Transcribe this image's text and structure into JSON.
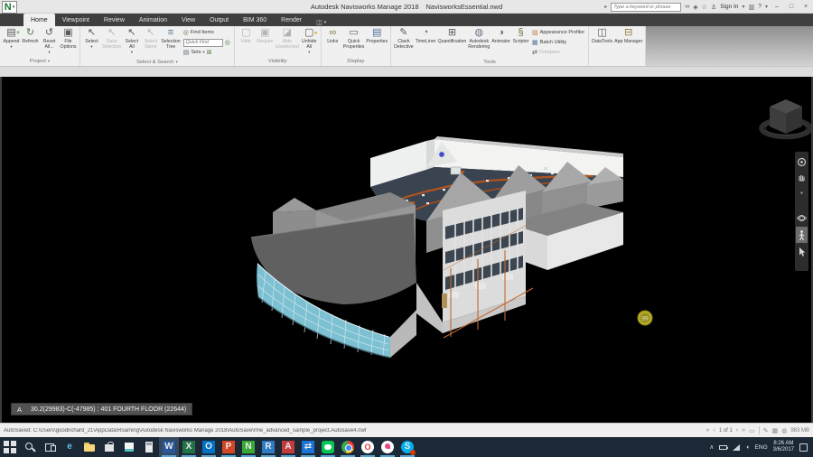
{
  "glyphs": {
    "dropdown": "▾",
    "caret_right": "▸",
    "minimize": "–",
    "maximize": "□",
    "close": "×",
    "question": "?",
    "cart": "▥",
    "star": "☆",
    "person": "♙",
    "binoculars": "∞",
    "exchange": "◈",
    "nav_first": "«",
    "nav_prev": "‹",
    "nav_next": "›",
    "nav_last": "»",
    "sheet": "▭",
    "pencil": "✎",
    "disk": "▦",
    "globe": "◍",
    "chevron_up": "∧",
    "volume": "◖",
    "ribbon_toggle": "◫"
  },
  "titlebar": {
    "logo_letter": "N",
    "title_app": "Autodesk Navisworks Manage 2018",
    "title_doc": "NavisworksEssential.nwd",
    "search_placeholder": "Type a keyword or phrase",
    "signin_label": "Sign In"
  },
  "tabs": [
    {
      "name": "tab-home",
      "label": "Home",
      "active": true
    },
    {
      "name": "tab-viewpoint",
      "label": "Viewpoint"
    },
    {
      "name": "tab-review",
      "label": "Review"
    },
    {
      "name": "tab-animation",
      "label": "Animation"
    },
    {
      "name": "tab-view",
      "label": "View"
    },
    {
      "name": "tab-output",
      "label": "Output"
    },
    {
      "name": "tab-bim360",
      "label": "BIM 360"
    },
    {
      "name": "tab-render",
      "label": "Render"
    }
  ],
  "ribbon": {
    "groups": [
      {
        "label": "Project",
        "buttons": [
          {
            "name": "append-button",
            "icon": "▤",
            "badge": "+",
            "bcolor": "#2e8b2e",
            "l1": "Append",
            "l2": "",
            "arrow": true
          },
          {
            "name": "refresh-button",
            "icon": "↻",
            "icolor": "#5a7a5a",
            "l1": "Refresh",
            "l2": ""
          },
          {
            "name": "reset-all-button",
            "icon": "↺",
            "l1": "Reset",
            "l2": "All...",
            "arrow": true
          },
          {
            "name": "file-options-button",
            "icon": "▣",
            "l1": "File",
            "l2": "Options"
          }
        ]
      },
      {
        "label": "Select & Search",
        "buttons": [
          {
            "name": "select-button",
            "icon": "↖",
            "l1": "Select",
            "l2": "",
            "arrow": true
          },
          {
            "name": "save-selection-button",
            "icon": "↖",
            "l1": "Save",
            "l2": "Selection",
            "disabled": true
          },
          {
            "name": "select-all-button",
            "icon": "↖",
            "l1": "Select",
            "l2": "All",
            "arrow": true
          },
          {
            "name": "select-same-button",
            "icon": "↖",
            "l1": "Select",
            "l2": "Same",
            "disabled": true
          },
          {
            "name": "selection-tree-button",
            "icon": "≡",
            "icolor": "#4f7396",
            "l1": "Selection",
            "l2": "Tree"
          }
        ]
      },
      {
        "label": "Visibility",
        "buttons": [
          {
            "name": "hide-button",
            "icon": "▢",
            "l1": "Hide",
            "l2": "",
            "disabled": true
          },
          {
            "name": "require-button",
            "icon": "▣",
            "l1": "Require",
            "l2": "",
            "disabled": true
          },
          {
            "name": "hide-unselected-button",
            "icon": "◪",
            "l1": "Hide",
            "l2": "Unselected",
            "disabled": true
          },
          {
            "name": "unhide-all-button",
            "icon": "▢",
            "badge": "●",
            "bcolor": "#d8b818",
            "l1": "Unhide",
            "l2": "All",
            "arrow": true
          }
        ]
      },
      {
        "label": "Display",
        "buttons": [
          {
            "name": "links-button",
            "icon": "∞",
            "icolor": "#8a7250",
            "l1": "Links",
            "l2": ""
          },
          {
            "name": "quick-properties-button",
            "icon": "▭",
            "icolor": "#5a6a7a",
            "l1": "Quick",
            "l2": "Properties"
          },
          {
            "name": "properties-button",
            "icon": "▤",
            "icolor": "#4f7396",
            "l1": "Properties",
            "l2": ""
          }
        ]
      },
      {
        "label": "Tools",
        "buttons": [
          {
            "name": "clash-detective-button",
            "icon": "✎",
            "l1": "Clash",
            "l2": "Detective"
          },
          {
            "name": "timeliner-button",
            "icon": "◔",
            "icolor": "#5a6a8a",
            "l1": "TimeLiner",
            "l2": ""
          },
          {
            "name": "quantification-button",
            "icon": "⊞",
            "l1": "Quantification",
            "l2": ""
          },
          {
            "name": "autodesk-rendering-button",
            "icon": "◍",
            "icolor": "#7a6a8a",
            "l1": "Autodesk",
            "l2": "Rendering"
          },
          {
            "name": "animator-button",
            "icon": "◑",
            "icolor": "#5a7a5a",
            "l1": "Animator",
            "l2": ""
          },
          {
            "name": "scripter-button",
            "icon": "§",
            "icolor": "#7a6a4a",
            "l1": "Scripter",
            "l2": ""
          }
        ],
        "stack": [
          {
            "name": "appearance-profiler-button",
            "icon": "▨",
            "icolor": "#c8783a",
            "label": "Appearance Profiler"
          },
          {
            "name": "batch-utility-button",
            "icon": "▦",
            "icolor": "#4f7396",
            "label": "Batch Utility"
          },
          {
            "name": "compare-button",
            "icon": "⇄",
            "label": "Compare",
            "disabled": true
          }
        ]
      },
      {
        "label": "",
        "buttons": [
          {
            "name": "datatools-button",
            "icon": "◫",
            "l1": "DataTools",
            "l2": ""
          },
          {
            "name": "app-manager-button",
            "icon": "⊟",
            "icolor": "#8a7a3a",
            "l1": "App Manager",
            "l2": ""
          }
        ]
      }
    ],
    "find_items_label": "Find Items",
    "quick_find_placeholder": "Quick Find",
    "sets_label": "Sets",
    "find_items_icon": "◎",
    "quick_find_icon": "◎",
    "sets_icon": "▤",
    "sets_grid_icon": "⊞"
  },
  "qat": {
    "items": [
      {
        "name": "new-icon",
        "glyph": "▢"
      },
      {
        "name": "open-icon",
        "glyph": "▤"
      },
      {
        "name": "save-icon",
        "glyph": "▦",
        "color": "#3c6ea5"
      },
      {
        "name": "print-icon",
        "glyph": "▥"
      },
      {
        "name": "undo-icon",
        "glyph": "↶",
        "color": "#9a9a9a"
      },
      {
        "name": "redo-icon",
        "glyph": "↷",
        "color": "#b5b5b5"
      },
      {
        "name": "refresh-small-icon",
        "glyph": "⊙",
        "color": "#8a8a8a"
      },
      {
        "name": "select-small-icon",
        "glyph": "↖",
        "color": "#8a8a8a"
      },
      {
        "name": "qat-overflow-icon",
        "glyph": "▪",
        "color": "#777777"
      }
    ]
  },
  "viewport": {
    "toolbar": [
      {
        "name": "viewpoint-save-icon",
        "glyph": "▢"
      },
      {
        "name": "viewpoint-box-icon",
        "glyph": "▣"
      },
      {
        "name": "viewpoint-menu-icon",
        "glyph": "≡"
      },
      {
        "name": "viewpoint-clip-icon",
        "glyph": "◈"
      },
      {
        "name": "viewpoint-grid-icon",
        "glyph": "▦"
      },
      {
        "name": "viewpoint-sheet-icon",
        "glyph": "▤"
      }
    ],
    "tag_value": "99",
    "selection_marker": "A",
    "selection_text": "30.2(29983)-C(-47985) : 401 FOURTH FLOOR (22644)"
  },
  "statusbar": {
    "autosave": "AutoSaved: C:\\Users\\goodrichard_21\\AppData\\Roaming\\Autodesk Navisworks Manage 2018\\AutoSave\\rme_advanced_sample_project.Autosave4.nwf",
    "page_indicator": "1 of 1",
    "memory": "983 MB"
  },
  "taskbar": {
    "apps": [
      {
        "name": "start-button",
        "cls": "ic-win"
      },
      {
        "name": "taskbar-search-button",
        "cls": "ic-search"
      },
      {
        "name": "task-view-button",
        "cls": "ic-taskview"
      },
      {
        "name": "edge-icon",
        "glyph": "e",
        "color": "#5ec2ee"
      },
      {
        "name": "file-explorer-icon",
        "cls": "ic-folder"
      },
      {
        "name": "store-icon",
        "cls": "ic-store"
      },
      {
        "name": "notes-icon",
        "cls": "ic-note"
      },
      {
        "name": "calculator-icon",
        "cls": "ic-calc"
      },
      {
        "name": "word-icon",
        "glyph": "W",
        "tile": "#2b579a",
        "hl": true,
        "underline": true
      },
      {
        "name": "excel-icon",
        "glyph": "X",
        "tile": "#217346",
        "underline": true
      },
      {
        "name": "outlook-icon",
        "glyph": "O",
        "tile": "#0072c6",
        "underline": true
      },
      {
        "name": "powerpoint-icon",
        "glyph": "P",
        "tile": "#d24726",
        "underline": true
      },
      {
        "name": "navisworks-icon",
        "glyph": "N",
        "tile": "#39a935",
        "underline": true
      },
      {
        "name": "revit-icon",
        "glyph": "R",
        "tile": "#2f7bc4",
        "underline": true
      },
      {
        "name": "autocad-icon",
        "glyph": "A",
        "tile": "#c43b3b",
        "underline": true
      },
      {
        "name": "teamviewer-icon",
        "glyph": "⇄",
        "tile": "#1a73d8",
        "underline": true
      },
      {
        "name": "line-icon",
        "cls": "ic-line",
        "underline": true
      },
      {
        "name": "chrome-icon",
        "cls": "ic-chrome",
        "underline": true
      },
      {
        "name": "opera-icon",
        "glyph": "O",
        "cls": "ic-opera",
        "round": true,
        "underline": true
      },
      {
        "name": "pink-app-icon",
        "cls": "ic-pink",
        "underline": true
      },
      {
        "name": "skype-icon",
        "glyph": "S",
        "tile": "#00aff0",
        "round": true,
        "underline": true,
        "badge": true
      }
    ],
    "tray": {
      "lang": "ENG",
      "time": "8:26 AM",
      "date": "3/6/2017"
    }
  }
}
